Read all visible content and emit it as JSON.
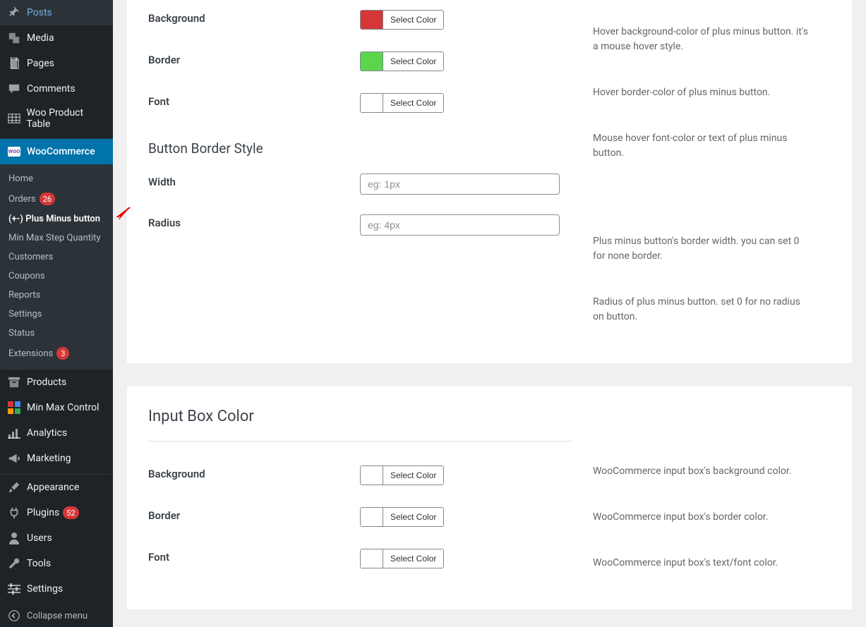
{
  "sidebar": {
    "posts": "Posts",
    "media": "Media",
    "pages": "Pages",
    "comments": "Comments",
    "woo_product_table": "Woo Product Table",
    "woocommerce": "WooCommerce",
    "submenu": {
      "home": "Home",
      "orders": "Orders",
      "orders_count": "26",
      "plus_minus": "(+-) Plus Minus button",
      "min_max_step": "Min Max Step Quantity",
      "customers": "Customers",
      "coupons": "Coupons",
      "reports": "Reports",
      "settings": "Settings",
      "status": "Status",
      "extensions": "Extensions",
      "extensions_count": "3"
    },
    "products": "Products",
    "min_max_control": "Min Max Control",
    "analytics": "Analytics",
    "marketing": "Marketing",
    "appearance": "Appearance",
    "plugins": "Plugins",
    "plugins_count": "52",
    "users": "Users",
    "tools": "Tools",
    "settings": "Settings",
    "collapse": "Collapse menu"
  },
  "panel1": {
    "rows": {
      "background": {
        "label": "Background",
        "swatch": "#d63638",
        "btn": "Select Color"
      },
      "border": {
        "label": "Border",
        "swatch": "#5bd64a",
        "btn": "Select Color"
      },
      "font": {
        "label": "Font",
        "swatch": "#ffffff",
        "btn": "Select Color"
      }
    },
    "desc": {
      "background": "Hover background-color of plus minus button. it's a mouse hover style.",
      "border": "Hover border-color of plus minus button.",
      "font": "Mouse hover font-color or text of plus minus button."
    },
    "section2_title": "Button Border Style",
    "width": {
      "label": "Width",
      "placeholder": "eg: 1px"
    },
    "radius": {
      "label": "Radius",
      "placeholder": "eg: 4px"
    },
    "desc2": {
      "width": "Plus minus button's border width. you can set 0 for none border.",
      "radius": "Radius of plus minus button. set 0 for no radius on button."
    }
  },
  "panel2": {
    "title": "Input Box Color",
    "rows": {
      "background": {
        "label": "Background",
        "swatch": "#ffffff",
        "btn": "Select Color"
      },
      "border": {
        "label": "Border",
        "swatch": "#ffffff",
        "btn": "Select Color"
      },
      "font": {
        "label": "Font",
        "swatch": "#ffffff",
        "btn": "Select Color"
      }
    },
    "desc": {
      "background": "WooCommerce input box's background color.",
      "border": "WooCommerce input box's border color.",
      "font": "WooCommerce input box's text/font color."
    }
  },
  "colors": {
    "red": "#d63638",
    "green": "#5bd64a"
  }
}
